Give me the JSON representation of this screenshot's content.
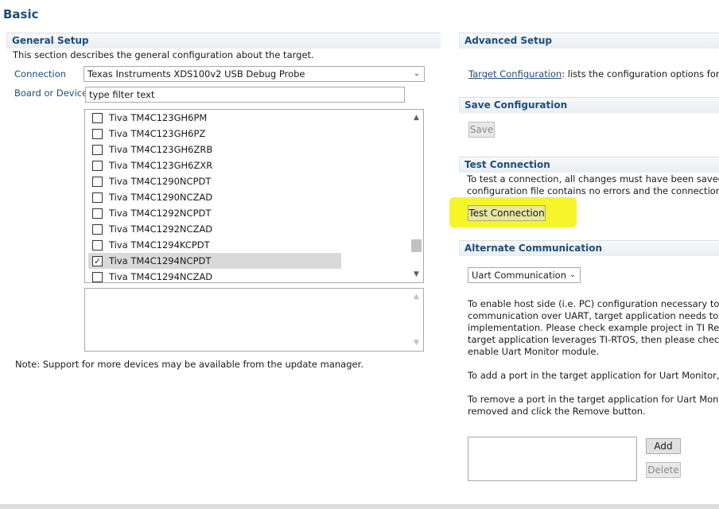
{
  "page": {
    "title": "Basic"
  },
  "general_setup": {
    "heading": "General Setup",
    "description": "This section describes the general configuration about the target.",
    "connection_label": "Connection",
    "connection_value": "Texas Instruments XDS100v2 USB Debug Probe",
    "board_label": "Board or Device",
    "filter_placeholder": "type filter text",
    "devices": [
      {
        "name": "Tiva TM4C123GH6PM",
        "checked": false
      },
      {
        "name": "Tiva TM4C123GH6PZ",
        "checked": false
      },
      {
        "name": "Tiva TM4C123GH6ZRB",
        "checked": false
      },
      {
        "name": "Tiva TM4C123GH6ZXR",
        "checked": false
      },
      {
        "name": "Tiva TM4C1290NCPDT",
        "checked": false
      },
      {
        "name": "Tiva TM4C1290NCZAD",
        "checked": false
      },
      {
        "name": "Tiva TM4C1292NCPDT",
        "checked": false
      },
      {
        "name": "Tiva TM4C1292NCZAD",
        "checked": false
      },
      {
        "name": "Tiva TM4C1294KCPDT",
        "checked": false
      },
      {
        "name": "Tiva TM4C1294NCPDT",
        "checked": true
      },
      {
        "name": "Tiva TM4C1294NCZAD",
        "checked": false
      }
    ],
    "note": "Note: Support for more devices may be available from the update manager."
  },
  "advanced_setup": {
    "heading": "Advanced Setup",
    "link": "Target Configuration",
    "link_suffix": ": lists the configuration options for th"
  },
  "save_configuration": {
    "heading": "Save Configuration",
    "save_label": "Save"
  },
  "test_connection": {
    "heading": "Test Connection",
    "line1": "To test a connection, all changes must have been saved, th",
    "line2": "configuration file contains no errors and the connection typ",
    "button_label": "Test Connection",
    "highlight_color": "#f5f52a"
  },
  "alternate_communication": {
    "heading": "Alternate Communication",
    "selected": "Uart Communication",
    "para1": [
      "To enable host side (i.e. PC) configuration necessary to fac",
      "communication over UART, target application needs to inc",
      "implementation. Please check example project in TI Resour",
      "target application leverages TI-RTOS, then please check do",
      "enable Uart Monitor module."
    ],
    "para2": "To add a port in the target application for Uart Monitor, cli",
    "para3": [
      "To remove a port in the target application for Uart Monitor",
      "removed and click the Remove button."
    ],
    "add_label": "Add",
    "delete_label": "Delete"
  },
  "icons": {
    "chevron_down": "⌄",
    "checkmark": "✓",
    "scroll_up": "▲",
    "scroll_down": "▼"
  }
}
